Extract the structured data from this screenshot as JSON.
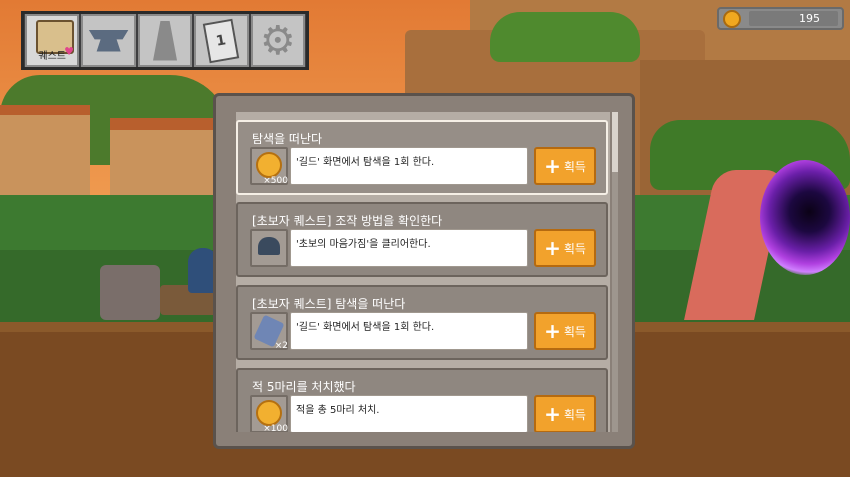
{
  "toolbar": {
    "tabs": [
      {
        "label": "퀘스트",
        "icon": "quest-scroll-icon",
        "active": true
      },
      {
        "label": "",
        "icon": "anvil-icon"
      },
      {
        "label": "",
        "icon": "tower-icon"
      },
      {
        "label": "",
        "icon": "card-icon",
        "badge": "1"
      },
      {
        "label": "",
        "icon": "gear-icon"
      }
    ]
  },
  "gold": {
    "value": "195",
    "icon": "gold-coin-icon"
  },
  "quests": [
    {
      "title": "탐색을 떠난다",
      "description": "'길드' 화면에서 탐색을 1회 한다.",
      "reward_icon": "gold-coin-icon",
      "reward_count": "×500",
      "button": "획득"
    },
    {
      "title": "[초보자 퀘스트] 조작 방법을 확인한다",
      "description": "'초보의 마음가짐'을 클리어한다.",
      "reward_icon": "helmet-icon",
      "reward_count": "",
      "button": "획득"
    },
    {
      "title": "[초보자 퀘스트] 탐색을 떠난다",
      "description": "'길드' 화면에서 탐색을 1회 한다.",
      "reward_icon": "scroll-icon",
      "reward_count": "×2",
      "button": "획득"
    },
    {
      "title": "적 5마리를 처치했다",
      "description": "적을 총 5마리 처치.",
      "reward_icon": "gold-coin-icon",
      "reward_count": "×100",
      "button": "획득"
    }
  ],
  "colors": {
    "button": "#f2a22c",
    "panel": "#8a8078",
    "sky": "#e27a34"
  }
}
